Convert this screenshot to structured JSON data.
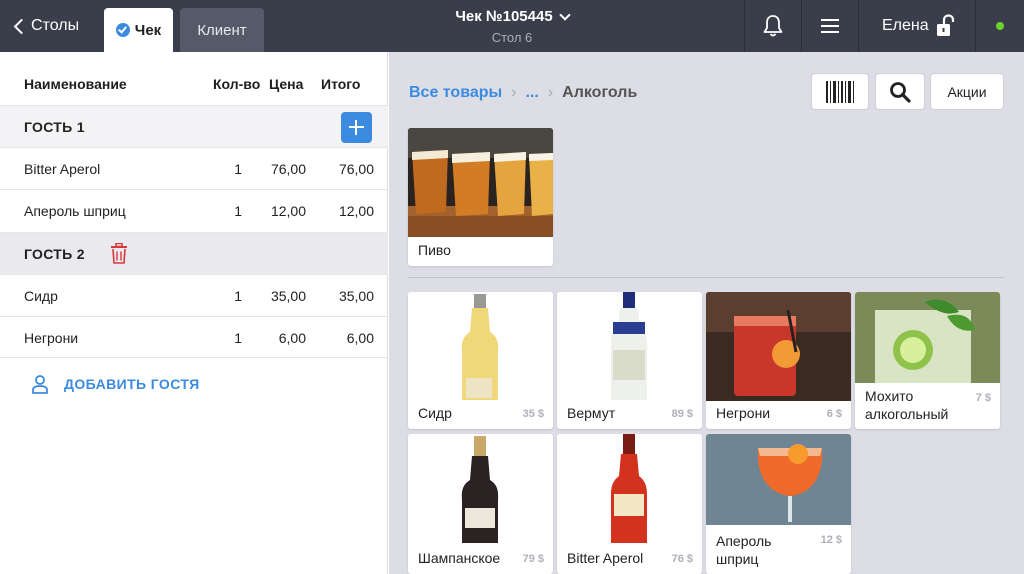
{
  "topbar": {
    "back_label": "Столы",
    "tabs": [
      {
        "label": "Чек",
        "active": true
      },
      {
        "label": "Клиент",
        "active": false
      }
    ],
    "title": "Чек №105445",
    "subtitle": "Стол 6",
    "user_name": "Елена",
    "icons": [
      "bell-icon",
      "menu-icon",
      "unlock-icon"
    ],
    "status_color": "#6bd12f"
  },
  "order": {
    "headers": {
      "name": "Наименование",
      "qty": "Кол-во",
      "price": "Цена",
      "total": "Итого"
    },
    "guests": [
      {
        "label": "ГОСТЬ 1",
        "items": [
          {
            "name": "Bitter Aperol",
            "qty": "1",
            "price": "76,00",
            "total": "76,00"
          },
          {
            "name": "Апероль шприц",
            "qty": "1",
            "price": "12,00",
            "total": "12,00"
          }
        ]
      },
      {
        "label": "ГОСТЬ 2",
        "items": [
          {
            "name": "Сидр",
            "qty": "1",
            "price": "35,00",
            "total": "35,00"
          },
          {
            "name": "Негрони",
            "qty": "1",
            "price": "6,00",
            "total": "6,00"
          }
        ]
      }
    ],
    "add_guest_label": "ДОБАВИТЬ ГОСТЯ"
  },
  "catalog": {
    "breadcrumb": [
      "Все товары",
      "...",
      "Алкоголь"
    ],
    "promo_button": "Акции",
    "categories": [
      {
        "name": "Пиво"
      }
    ],
    "products": [
      {
        "name": "Сидр",
        "price": "35 $"
      },
      {
        "name": "Вермут",
        "price": "89 $"
      },
      {
        "name": "Негрони",
        "price": "6 $"
      },
      {
        "name": "Мохито алкогольный",
        "price": "7 $"
      },
      {
        "name": "Шампанское",
        "price": "79 $"
      },
      {
        "name": "Bitter Aperol",
        "price": "76 $"
      },
      {
        "name": "Апероль шприц",
        "price": "12 $"
      }
    ]
  },
  "colors": {
    "accent": "#3b8be0",
    "topbar": "#3a3e4b",
    "danger": "#d9383a"
  }
}
